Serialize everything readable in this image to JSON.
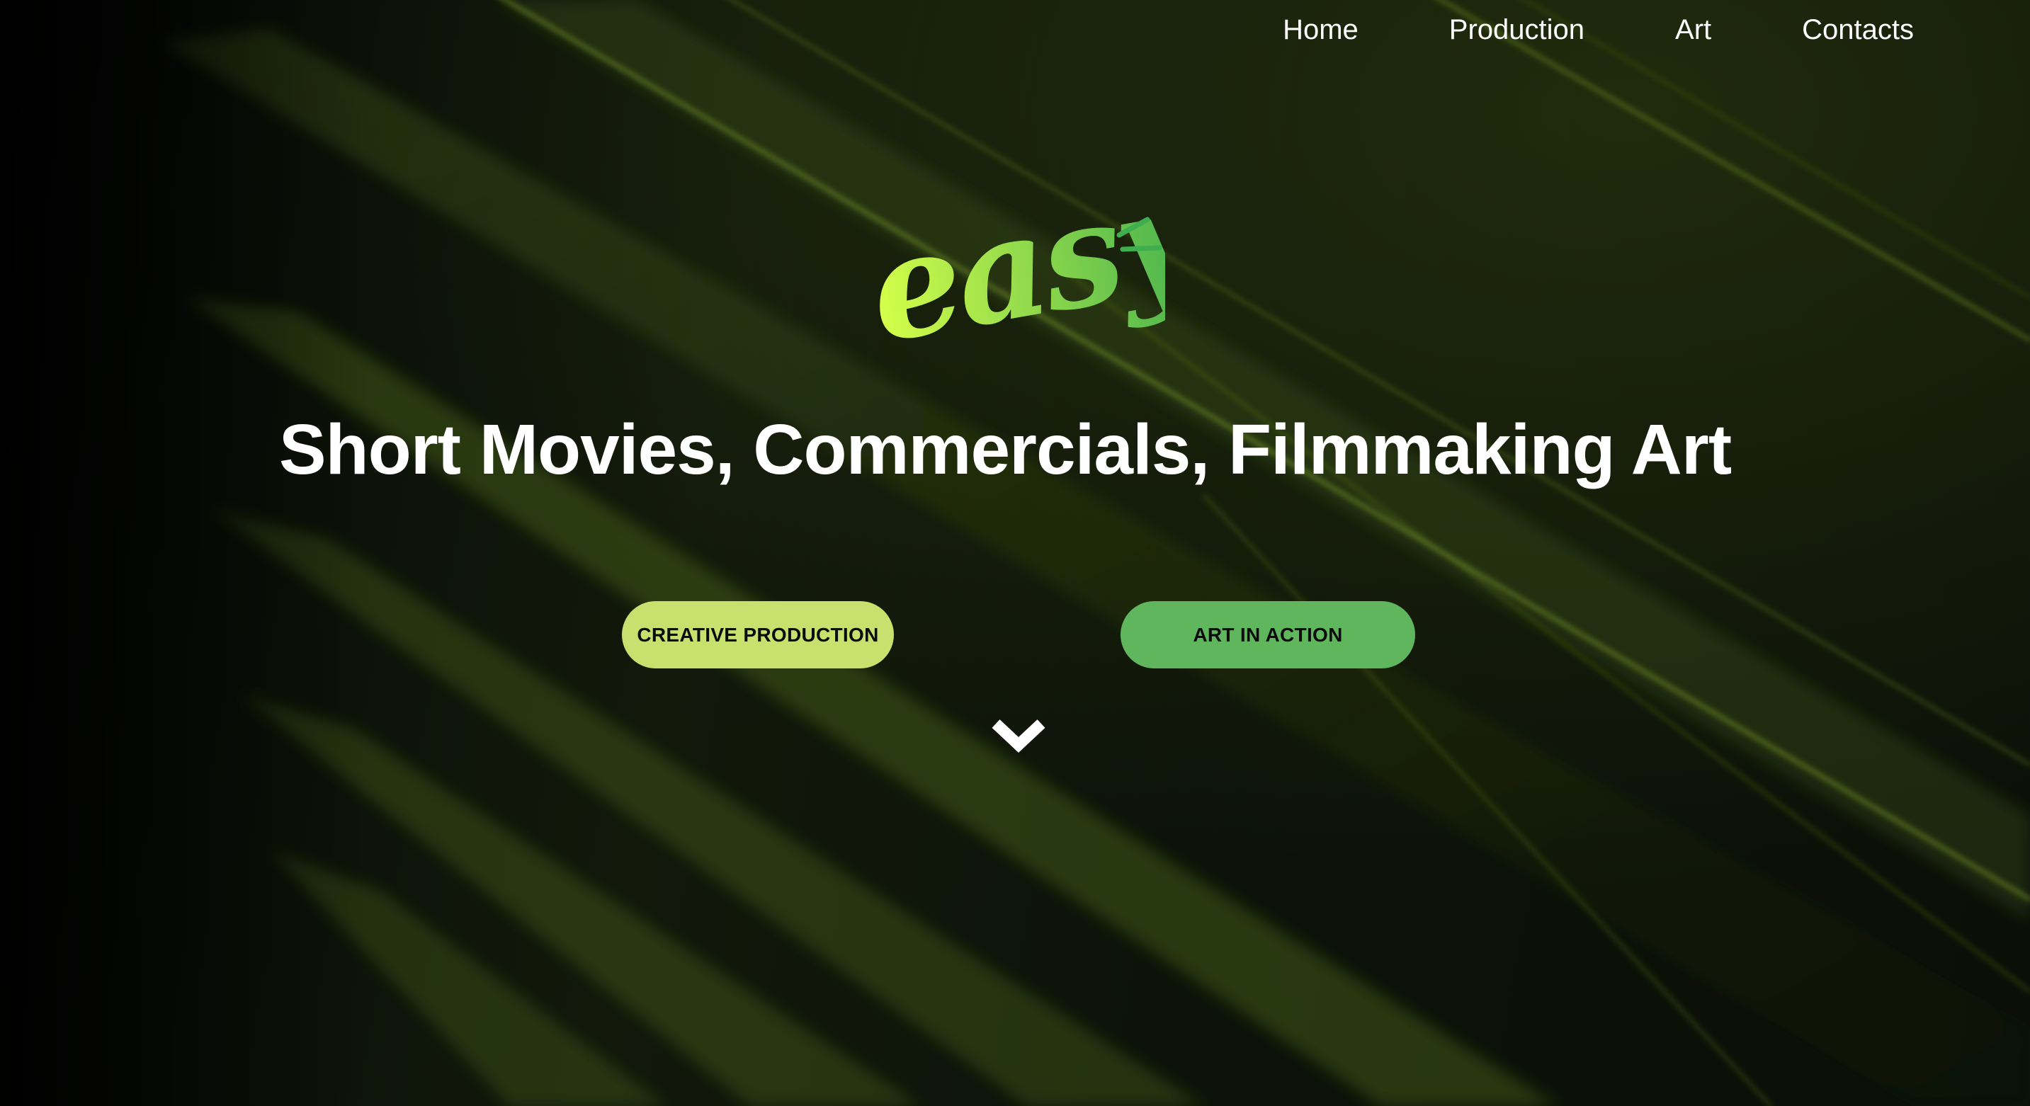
{
  "nav": {
    "items": [
      {
        "label": "Home"
      },
      {
        "label": "Production"
      },
      {
        "label": "Art"
      },
      {
        "label": "Contacts"
      }
    ]
  },
  "logo": {
    "text": "easy",
    "gradient_start": "#d6ff4a",
    "gradient_end": "#3fae4e"
  },
  "hero": {
    "headline": "Short Movies, Commercials, Filmmaking Art"
  },
  "buttons": {
    "creative_production": "CREATIVE PRODUCTION",
    "art_in_action": "ART IN ACTION"
  },
  "icons": {
    "scroll_down": "chevron-down-icon"
  },
  "colors": {
    "background": "#070906",
    "accent_light": "#c7e06e",
    "accent_green": "#5fb65c",
    "text": "#ffffff"
  }
}
